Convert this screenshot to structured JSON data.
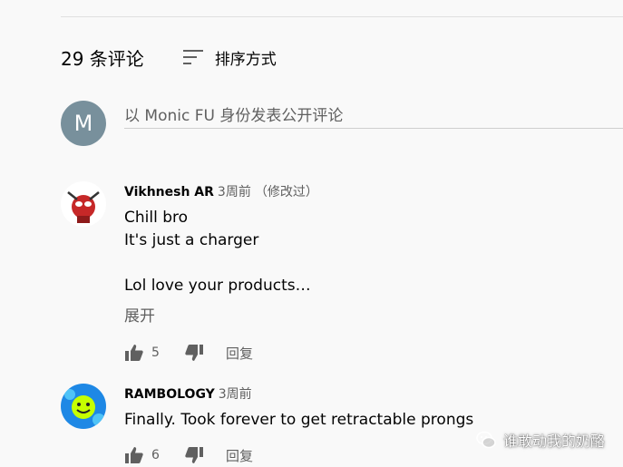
{
  "comments_header": {
    "count_label": "29 条评论",
    "sort_label": "排序方式"
  },
  "composer": {
    "avatar_letter": "M",
    "placeholder": "以 Monic FU 身份发表公开评论"
  },
  "comments": [
    {
      "author": "Vikhnesh AR",
      "time": "3周前",
      "edited": "（修改过）",
      "lines": [
        "Chill bro",
        "It's just a charger",
        "",
        "Lol love your products…"
      ],
      "expand_label": "展开",
      "likes": "5",
      "reply_label": "回复"
    },
    {
      "author": "RAMBOLOGY",
      "time": "3周前",
      "lines": [
        "Finally. Took forever to get retractable prongs"
      ],
      "likes": "6",
      "reply_label": "回复"
    }
  ],
  "watermark": {
    "text": "谁敢动我的奶酪"
  },
  "colors": {
    "background": "#f9f9f9",
    "secondary_text": "#606060",
    "avatar_bg": "#78909c"
  }
}
